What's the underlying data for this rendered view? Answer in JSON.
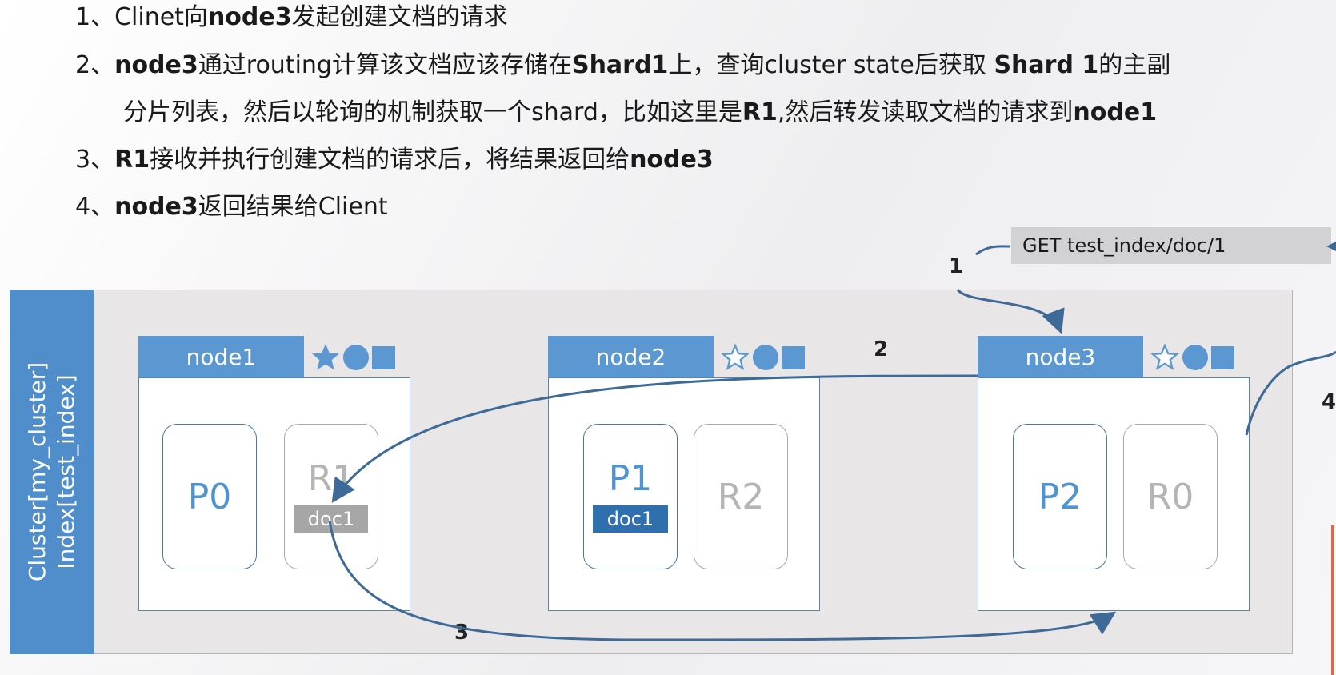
{
  "steps": [
    [
      {
        "t": "1、Clinet向"
      },
      {
        "t": "node3",
        "b": true
      },
      {
        "t": "发起创建文档的请求"
      }
    ],
    [
      {
        "t": "2、"
      },
      {
        "t": "node3",
        "b": true
      },
      {
        "t": "通过routing计算该文档应该存储在"
      },
      {
        "t": "Shard1",
        "b": true
      },
      {
        "t": "上，查询cluster state后获取 "
      },
      {
        "t": "Shard 1",
        "b": true
      },
      {
        "t": "的主副"
      }
    ],
    [
      {
        "t": "分片列表，然后以轮询的机制获取一个shard，比如这里是"
      },
      {
        "t": "R1",
        "b": true
      },
      {
        "t": ",然后转发读取文档的请求到"
      },
      {
        "t": "node1",
        "b": true
      }
    ],
    [
      {
        "t": "3、"
      },
      {
        "t": "R1",
        "b": true
      },
      {
        "t": "接收并执行创建文档的请求后，将结果返回给"
      },
      {
        "t": "node3",
        "b": true
      }
    ],
    [
      {
        "t": "4、"
      },
      {
        "t": "node3",
        "b": true
      },
      {
        "t": "返回结果给Client"
      }
    ]
  ],
  "cluster": {
    "label_line1": "Cluster[my_cluster]",
    "label_line2": "Index[test_index]"
  },
  "request": "GET test_index/doc/1",
  "step_numbers": {
    "n1": "1",
    "n2": "2",
    "n3": "3",
    "n4": "4"
  },
  "nodes": [
    {
      "name": "node1",
      "master_star": true,
      "shards": [
        {
          "label": "P0",
          "kind": "primary"
        },
        {
          "label": "R1",
          "kind": "replica",
          "doc": "doc1"
        }
      ]
    },
    {
      "name": "node2",
      "master_star": false,
      "shards": [
        {
          "label": "P1",
          "kind": "primary",
          "doc": "doc1"
        },
        {
          "label": "R2",
          "kind": "replica"
        }
      ]
    },
    {
      "name": "node3",
      "master_star": false,
      "shards": [
        {
          "label": "P2",
          "kind": "primary"
        },
        {
          "label": "R0",
          "kind": "replica"
        }
      ]
    }
  ],
  "colors": {
    "accent_blue": "#5b97d0",
    "primary_text": "#4e93d2",
    "replica_text": "#b4b4b4",
    "doc_blue": "#2f6fae",
    "doc_gray": "#a6a6a6",
    "arrow": "#3d6a96",
    "cluster_bg": "#e9e6e8"
  },
  "icons": [
    "star-icon",
    "circle-icon",
    "square-icon"
  ]
}
